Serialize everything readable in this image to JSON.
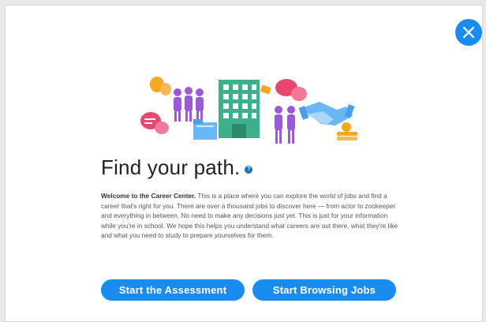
{
  "dialog": {
    "close_label": "",
    "title": "Find your path.",
    "help_glyph": "?",
    "intro_bold": "Welcome to the Career Center.",
    "intro_text": " This is a place where you can explore the world of jobs and find a career that's right for you. There are over a thousand jobs to discover here — from actor to zookeeper and everything in between. No need to make any decisions just yet. This is just for your information while you're in school. We hope this helps you understand what careers are out there, what they're like and what you need to study to prepare yourselves for them.",
    "buttons": {
      "assessment": "Start the Assessment",
      "browse": "Start Browsing Jobs"
    }
  },
  "colors": {
    "accent": "#1a8cf0",
    "building": "#3bb08a",
    "people_purple": "#9b59d6",
    "speech_pink": "#e8476f",
    "orange": "#f5a623",
    "light_blue": "#6ab7f5"
  },
  "icons": {
    "close": "close-icon",
    "help": "help-icon",
    "illustration": "career-illustration"
  }
}
